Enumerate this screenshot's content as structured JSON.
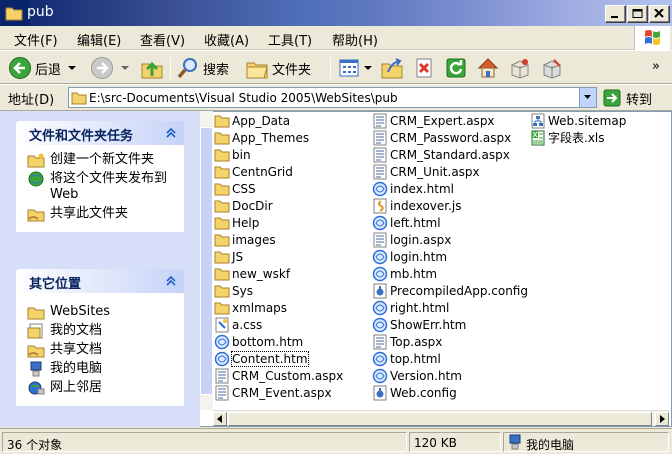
{
  "window": {
    "title": "pub",
    "min_label": "_",
    "max_label": "□",
    "close_label": "×"
  },
  "menu": [
    {
      "label": "文件(F)"
    },
    {
      "label": "编辑(E)"
    },
    {
      "label": "查看(V)"
    },
    {
      "label": "收藏(A)"
    },
    {
      "label": "工具(T)"
    },
    {
      "label": "帮助(H)"
    }
  ],
  "toolbar": {
    "back_label": "后退",
    "search_label": "搜索",
    "folders_label": "文件夹",
    "overflow": "»"
  },
  "address": {
    "label": "地址(D)",
    "path": "E:\\src-Documents\\Visual Studio 2005\\WebSites\\pub",
    "go_label": "转到"
  },
  "tasks_panel": {
    "title": "文件和文件夹任务",
    "items": [
      {
        "label": "创建一个新文件夹",
        "icon": "new-folder-icon"
      },
      {
        "label": "将这个文件夹发布到 Web",
        "icon": "publish-web-icon"
      },
      {
        "label": "共享此文件夹",
        "icon": "share-folder-icon"
      }
    ]
  },
  "places_panel": {
    "title": "其它位置",
    "items": [
      {
        "label": "WebSites",
        "icon": "folder-icon"
      },
      {
        "label": "我的文档",
        "icon": "my-documents-icon"
      },
      {
        "label": "共享文档",
        "icon": "shared-documents-icon"
      },
      {
        "label": "我的电脑",
        "icon": "my-computer-icon"
      },
      {
        "label": "网上邻居",
        "icon": "network-places-icon"
      }
    ]
  },
  "files": {
    "col1": [
      {
        "name": "App_Data",
        "type": "folder"
      },
      {
        "name": "App_Themes",
        "type": "folder"
      },
      {
        "name": "bin",
        "type": "folder"
      },
      {
        "name": "CentnGrid",
        "type": "folder"
      },
      {
        "name": "CSS",
        "type": "folder"
      },
      {
        "name": "DocDir",
        "type": "folder"
      },
      {
        "name": "Help",
        "type": "folder"
      },
      {
        "name": "images",
        "type": "folder"
      },
      {
        "name": "JS",
        "type": "folder"
      },
      {
        "name": "new_wskf",
        "type": "folder"
      },
      {
        "name": "Sys",
        "type": "folder"
      },
      {
        "name": "xmlmaps",
        "type": "folder"
      },
      {
        "name": "a.css",
        "type": "css"
      },
      {
        "name": "bottom.htm",
        "type": "htm"
      },
      {
        "name": "Content.htm",
        "type": "htm",
        "selected": true
      },
      {
        "name": "CRM_Custom.aspx",
        "type": "aspx"
      },
      {
        "name": "CRM_Event.aspx",
        "type": "aspx"
      }
    ],
    "col2": [
      {
        "name": "CRM_Expert.aspx",
        "type": "aspx"
      },
      {
        "name": "CRM_Password.aspx",
        "type": "aspx"
      },
      {
        "name": "CRM_Standard.aspx",
        "type": "aspx"
      },
      {
        "name": "CRM_Unit.aspx",
        "type": "aspx"
      },
      {
        "name": "index.html",
        "type": "htm"
      },
      {
        "name": "indexover.js",
        "type": "js"
      },
      {
        "name": "left.html",
        "type": "htm"
      },
      {
        "name": "login.aspx",
        "type": "aspx"
      },
      {
        "name": "login.htm",
        "type": "htm"
      },
      {
        "name": "mb.htm",
        "type": "htm"
      },
      {
        "name": "PrecompiledApp.config",
        "type": "config"
      },
      {
        "name": "right.html",
        "type": "htm"
      },
      {
        "name": "ShowErr.htm",
        "type": "htm"
      },
      {
        "name": "Top.aspx",
        "type": "aspx"
      },
      {
        "name": "top.html",
        "type": "htm"
      },
      {
        "name": "Version.htm",
        "type": "htm"
      },
      {
        "name": "Web.config",
        "type": "config"
      }
    ],
    "col3": [
      {
        "name": "Web.sitemap",
        "type": "sitemap"
      },
      {
        "name": "字段表.xls",
        "type": "xls"
      }
    ]
  },
  "status": {
    "count": "36 个对象",
    "size": "120 KB",
    "location": "我的电脑"
  },
  "colors": {
    "title_dark": "#0a246a",
    "folder": "#f5d36b",
    "ie_blue": "#2f6fd6",
    "panel_bg": "#d6dff7"
  }
}
